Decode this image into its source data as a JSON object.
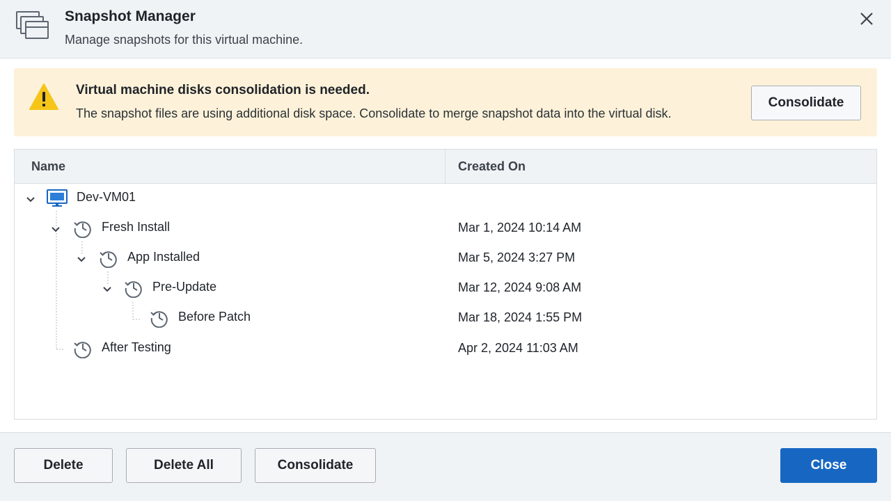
{
  "header": {
    "title": "Snapshot Manager",
    "subtitle": "Manage snapshots for this virtual machine.",
    "icon": "snapshots-icon",
    "close_icon": "close-icon"
  },
  "banner": {
    "icon": "warning-icon",
    "title": "Virtual machine disks consolidation is needed.",
    "text": "The snapshot files are using additional disk space. Consolidate to merge snapshot data into the virtual disk.",
    "button_label": "Consolidate",
    "color": "#fdf2d9"
  },
  "table": {
    "columns": [
      "Name",
      "Created On"
    ],
    "rows": [
      {
        "name": "Dev-VM01",
        "created": "",
        "level": 0,
        "icon": "vm-monitor-icon",
        "expanded": true
      },
      {
        "name": "Fresh Install",
        "created": "Mar 1, 2024 10:14 AM",
        "level": 1,
        "icon": "snapshot-clock-icon",
        "expanded": true
      },
      {
        "name": "App Installed",
        "created": "Mar 5, 2024 3:27 PM",
        "level": 2,
        "icon": "snapshot-clock-icon",
        "expanded": true
      },
      {
        "name": "Pre-Update",
        "created": "Mar 12, 2024 9:08 AM",
        "level": 3,
        "icon": "snapshot-clock-icon",
        "expanded": true
      },
      {
        "name": "Before Patch",
        "created": "Mar 18, 2024 1:55 PM",
        "level": 4,
        "icon": "snapshot-clock-icon",
        "expanded": false
      },
      {
        "name": "After Testing",
        "created": "Apr 2, 2024 11:03 AM",
        "level": 1,
        "icon": "snapshot-clock-icon",
        "expanded": false
      }
    ]
  },
  "footer": {
    "delete_label": "Delete",
    "delete_all_label": "Delete All",
    "consolidate_label": "Consolidate",
    "close_label": "Close"
  },
  "colors": {
    "accent": "#1767c2",
    "header_bg": "#f0f3f6",
    "warning": "#f5c518",
    "icon": "#5c6570"
  }
}
